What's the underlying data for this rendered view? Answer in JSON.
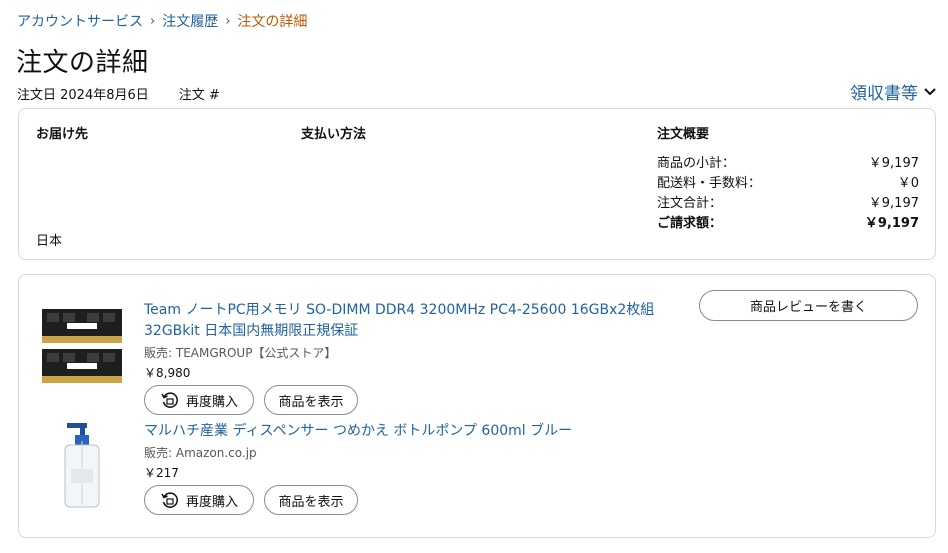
{
  "breadcrumb": {
    "account_service": "アカウントサービス",
    "order_history": "注文履歴",
    "current": "注文の詳細"
  },
  "page_title": "注文の詳細",
  "order": {
    "date_label": "注文日 2024年8月6日",
    "number_label": "注文 #"
  },
  "receipt_menu": "領収書等",
  "shipping": {
    "heading": "お届け先",
    "country": "日本"
  },
  "payment": {
    "heading": "支払い方法"
  },
  "summary": {
    "heading": "注文概要",
    "rows": [
      {
        "label": "商品の小計：",
        "value": "￥9,197"
      },
      {
        "label": "配送料・手数料：",
        "value": "￥0"
      },
      {
        "label": "注文合計：",
        "value": "￥9,197"
      },
      {
        "label": "ご請求額：",
        "value": "￥9,197"
      }
    ]
  },
  "review_button": "商品レビューを書く",
  "items": [
    {
      "title_line1": "Team ノートPC用メモリ SO-DIMM DDR4 3200MHz PC4-25600 16GBx2枚組",
      "title_line2": "32GBkit 日本国内無期限正規保証",
      "seller": "販売: TEAMGROUP【公式ストア】",
      "price": "￥8,980",
      "buy_again": "再度購入",
      "view_item": "商品を表示"
    },
    {
      "title_line1": "マルハチ産業 ディスペンサー つめかえ ボトルポンプ 600ml ブルー",
      "seller": "販売: Amazon.co.jp",
      "price": "￥217",
      "buy_again": "再度購入",
      "view_item": "商品を表示"
    }
  ],
  "colors": {
    "link": "#2162a1",
    "breadcrumb_current": "#c45500",
    "border": "#d5d9d9"
  }
}
